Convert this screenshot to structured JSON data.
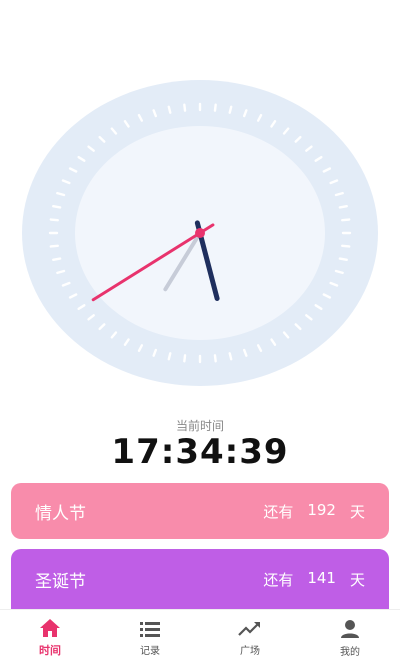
{
  "clock": {
    "hour": 17,
    "minute": 34,
    "second": 39,
    "face_color": "#f2f6fc",
    "rim_color": "#e3ecf7",
    "hour_hand_color": "#1f2f5e",
    "minute_hand_color": "#c7ccd8",
    "second_hand_color": "#e8336d"
  },
  "current_time": {
    "caption": "当前时间",
    "value": "17:34:39"
  },
  "events": [
    {
      "name": "情人节",
      "prefix": "还有",
      "days": "192",
      "unit": "天",
      "color": "#f88cab"
    },
    {
      "name": "圣诞节",
      "prefix": "还有",
      "days": "141",
      "unit": "天",
      "color": "#bf5ee6"
    }
  ],
  "tabs": [
    {
      "label": "时间",
      "icon": "home-icon",
      "active": true
    },
    {
      "label": "记录",
      "icon": "list-icon",
      "active": false
    },
    {
      "label": "广场",
      "icon": "trend-icon",
      "active": false
    },
    {
      "label": "我的",
      "icon": "user-icon",
      "active": false
    }
  ],
  "accent_color": "#e8336d"
}
